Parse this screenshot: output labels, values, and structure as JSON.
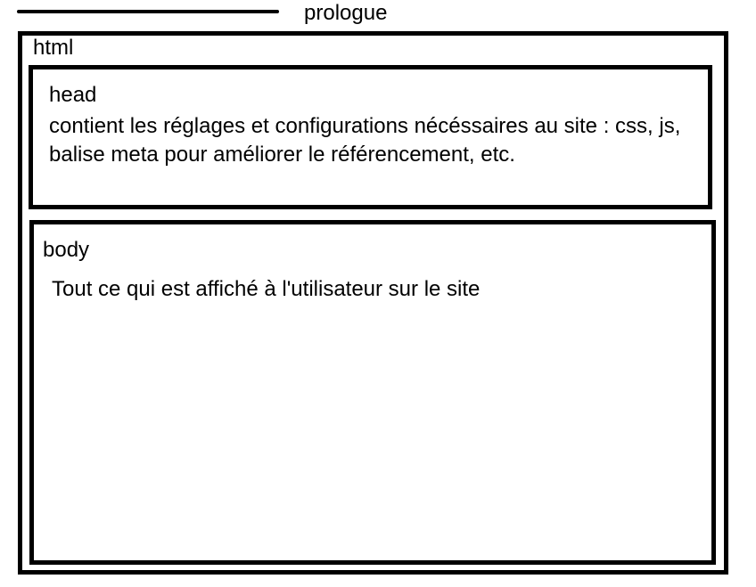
{
  "prologue": {
    "label": "prologue"
  },
  "html_block": {
    "label": "html",
    "head": {
      "label": "head",
      "description": "contient les réglages et configurations nécéssaires au site : css, js, balise meta pour améliorer le référencement, etc."
    },
    "body": {
      "label": "body",
      "description": "Tout ce qui est affiché à l'utilisateur sur le site"
    }
  }
}
